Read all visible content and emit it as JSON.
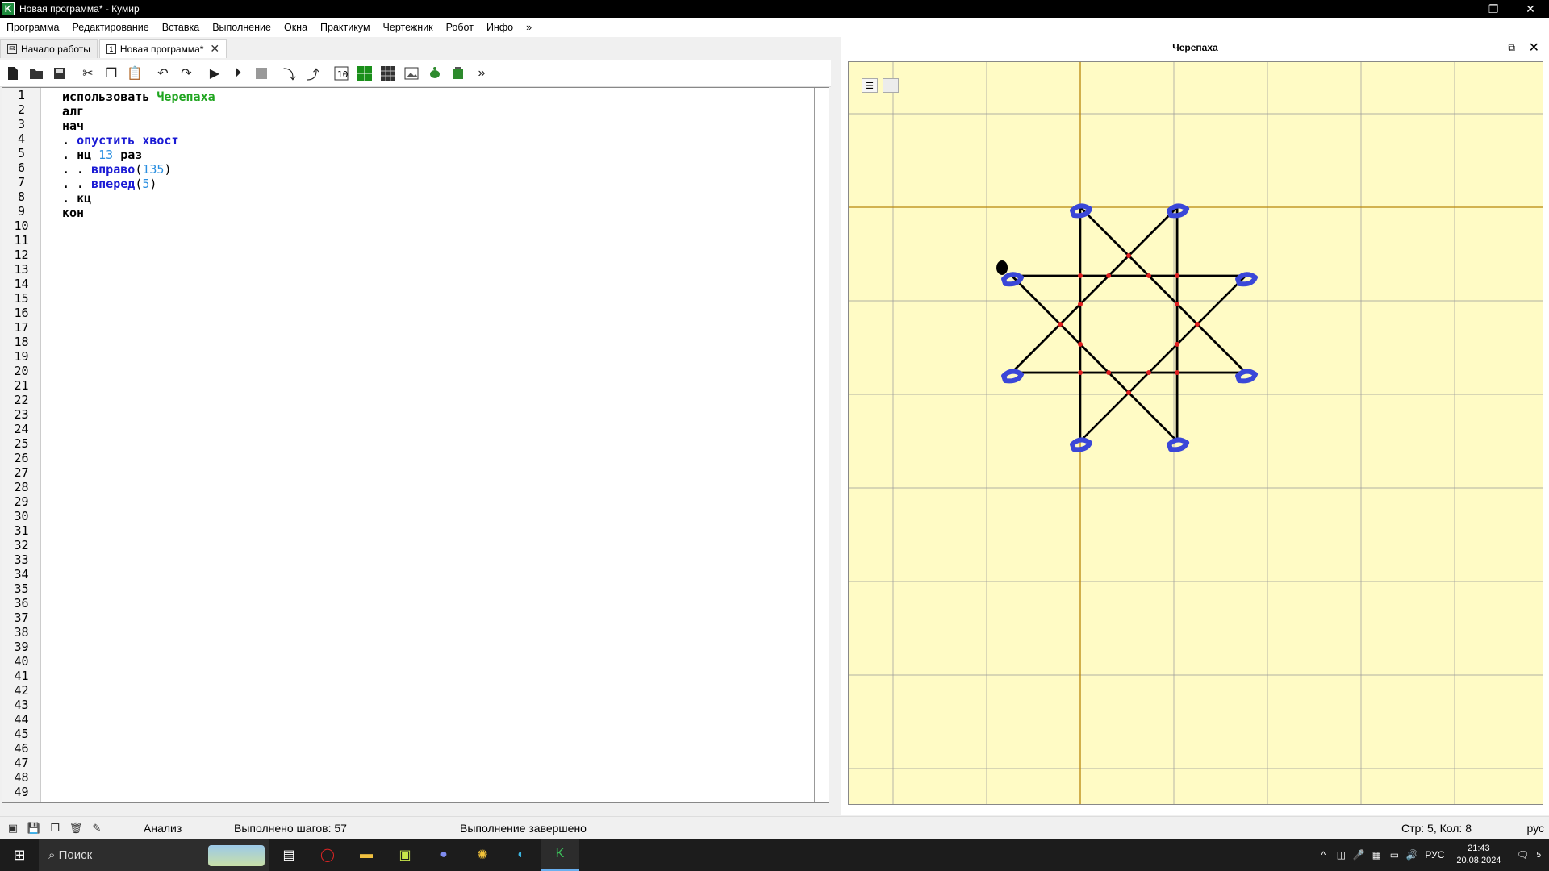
{
  "window": {
    "app_icon": "K",
    "title": "Новая программа* - Кумир",
    "min_label": "–",
    "restore_label": "❐",
    "close_label": "✕"
  },
  "menu": [
    "Программа",
    "Редактирование",
    "Вставка",
    "Выполнение",
    "Окна",
    "Практикум",
    "Чертежник",
    "Робот",
    "Инфо",
    "»"
  ],
  "tabs": [
    {
      "label": "Начало работы",
      "active": false
    },
    {
      "label": "Новая программа*",
      "active": true
    }
  ],
  "toolbar": {
    "icons": [
      "new-file-icon",
      "open-file-icon",
      "save-file-icon",
      "cut-icon",
      "copy-icon",
      "paste-icon",
      "undo-icon",
      "redo-icon",
      "run-icon",
      "run-step-icon",
      "stop-icon",
      "step-into-icon",
      "step-out-icon",
      "variables-icon",
      "robot-field-icon",
      "drawer-field-icon",
      "image-icon",
      "turtle-icon",
      "vodoley-icon"
    ],
    "more_label": "»"
  },
  "editor": {
    "line_count": 49,
    "lines": [
      [
        {
          "t": "использовать ",
          "c": "kw"
        },
        {
          "t": "Черепаха",
          "c": "mod"
        }
      ],
      [
        {
          "t": "алг",
          "c": "kw"
        }
      ],
      [
        {
          "t": "нач",
          "c": "kw"
        }
      ],
      [
        {
          "t": ". ",
          "c": "kw"
        },
        {
          "t": "опустить хвост",
          "c": "cmd"
        }
      ],
      [
        {
          "t": ". ",
          "c": "kw"
        },
        {
          "t": "нц ",
          "c": "kw"
        },
        {
          "t": "13",
          "c": "num"
        },
        {
          "t": " раз",
          "c": "kw"
        }
      ],
      [
        {
          "t": ". . ",
          "c": "kw"
        },
        {
          "t": "вправо",
          "c": "cmd"
        },
        {
          "t": "(",
          "c": "plain"
        },
        {
          "t": "135",
          "c": "num"
        },
        {
          "t": ")",
          "c": "plain"
        }
      ],
      [
        {
          "t": ". . ",
          "c": "kw"
        },
        {
          "t": "вперед",
          "c": "cmd"
        },
        {
          "t": "(",
          "c": "plain"
        },
        {
          "t": "5",
          "c": "num"
        },
        {
          "t": ")",
          "c": "plain"
        }
      ],
      [
        {
          "t": ". ",
          "c": "kw"
        },
        {
          "t": "кц",
          "c": "kw"
        }
      ],
      [
        {
          "t": "кон",
          "c": "kw"
        }
      ]
    ]
  },
  "turtle_panel": {
    "title": "Черепаха",
    "float_icon": "float-window-icon",
    "close_label": "✕",
    "mini_btn_label": "☰",
    "colors": {
      "background": "#fffbc5",
      "grid": "#999999",
      "axis": "#b8860b",
      "path": "#000000",
      "intersection": "#e02020",
      "annotation": "#3a47d8"
    }
  },
  "status": {
    "analysis": "Анализ",
    "steps": "Выполнено шагов: 57",
    "state": "Выполнение завершено",
    "position": "Стр: 5, Кол: 8",
    "lang": "рус"
  },
  "taskbar": {
    "search_placeholder": "Поиск",
    "apps": [
      "task-view-icon",
      "opera-icon",
      "explorer-icon",
      "pycharm-icon",
      "discord-icon",
      "sunburst-app-icon",
      "edge-icon",
      "kumir-icon"
    ],
    "lang": "РУС",
    "time": "21:43",
    "date": "20.08.2024",
    "notif_count": "5"
  }
}
